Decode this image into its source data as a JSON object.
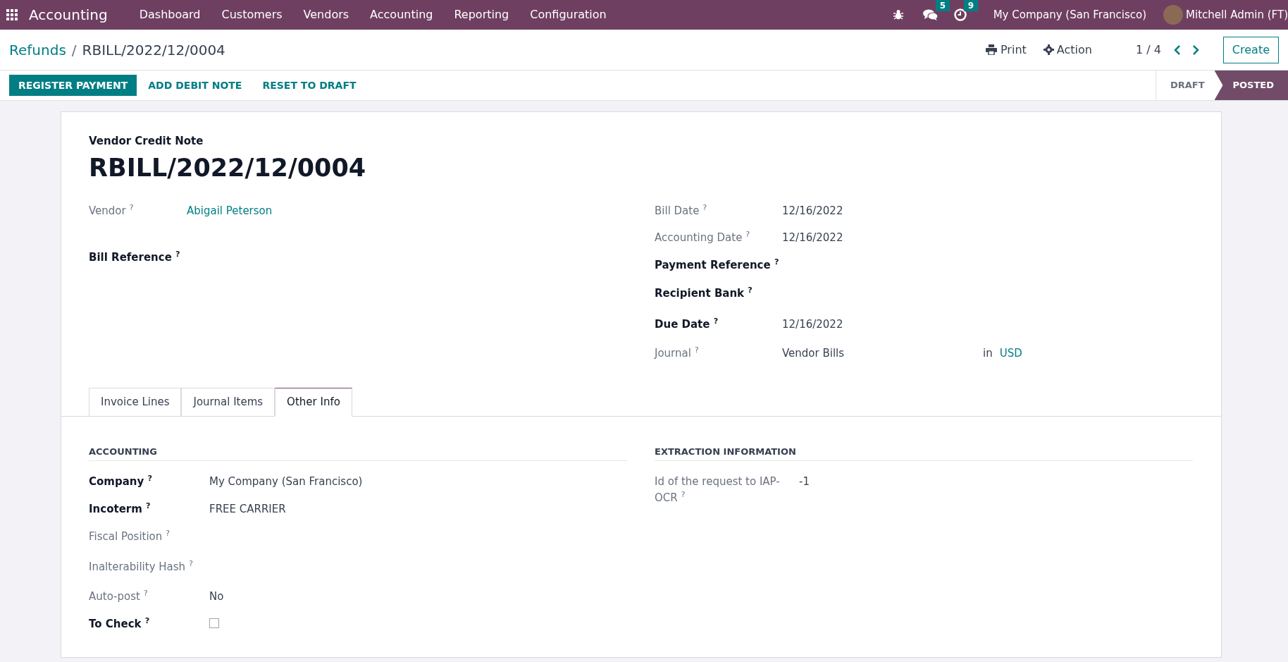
{
  "navbar": {
    "app_name": "Accounting",
    "menu": [
      "Dashboard",
      "Customers",
      "Vendors",
      "Accounting",
      "Reporting",
      "Configuration"
    ],
    "messages_count": "5",
    "activities_count": "9",
    "company": "My Company (San Francisco)",
    "user": "Mitchell Admin (FT)"
  },
  "control_panel": {
    "breadcrumb": [
      "Refunds",
      "RBILL/2022/12/0004"
    ],
    "breadcrumb_separator": "/",
    "print": "Print",
    "action": "Action",
    "pager": "1 / 4",
    "create": "Create"
  },
  "buttons": [
    {
      "label": "REGISTER PAYMENT",
      "primary": true
    },
    {
      "label": "ADD DEBIT NOTE",
      "primary": false
    },
    {
      "label": "RESET TO DRAFT",
      "primary": false
    }
  ],
  "status_steps": [
    {
      "label": "DRAFT",
      "selected": false
    },
    {
      "label": "POSTED",
      "selected": true
    }
  ],
  "form": {
    "type_label": "Vendor Credit Note",
    "name": "RBILL/2022/12/0004",
    "left_fields": [
      {
        "label": "Vendor $^{?}$",
        "required": false,
        "kind": "link",
        "value": "Abigail Peterson"
      },
      {
        "label": "Bill Reference $^{?}$",
        "required": true,
        "kind": "empty"
      }
    ],
    "right_fields": [
      {
        "label": "Bill Date $^{?}$",
        "required": false,
        "kind": "text",
        "value": "12/16/2022"
      },
      {
        "label": "Accounting Date $^{?}$",
        "required": false,
        "kind": "text",
        "value": "12/16/2022"
      },
      {
        "label": "Payment Reference $^{?}$",
        "required": true,
        "kind": "empty"
      },
      {
        "label": "Recipient Bank $^{?}$",
        "required": true,
        "kind": "empty"
      },
      {
        "label": "Due Date $^{?}$",
        "required": true,
        "kind": "text",
        "value": "12/16/2022"
      },
      {
        "label": "Journal $^{?}$",
        "required": false,
        "kind": "journal",
        "value": "Vendor Bills",
        "joiner": "in",
        "currency": "USD"
      }
    ],
    "tabs": [
      {
        "label": "Invoice Lines",
        "selected": false
      },
      {
        "label": "Journal Items",
        "selected": false
      },
      {
        "label": "Other Info",
        "selected": true
      }
    ],
    "sections": [
      {
        "title": "ACCOUNTING",
        "fields": [
          {
            "label": "Company $^{?}$",
            "required": true,
            "kind": "text",
            "value": "My Company (San Francisco)"
          },
          {
            "label": "Incoterm $^{?}$",
            "required": true,
            "kind": "text",
            "value": "FREE CARRIER"
          },
          {
            "label": "Fiscal Position $^{?}$",
            "required": false,
            "kind": "empty"
          },
          {
            "label": "Inalterability Hash $^{?}$",
            "required": false,
            "kind": "empty"
          },
          {
            "label": "Auto-post $^{?}$",
            "required": false,
            "kind": "text",
            "value": "No"
          },
          {
            "label": "To Check $^{?}$",
            "required": true,
            "kind": "checkbox",
            "checked": false
          }
        ]
      },
      {
        "title": "EXTRACTION INFORMATION",
        "fields": [
          {
            "label": "Id of the request to IAP-OCR $^{?}$",
            "required": false,
            "kind": "text",
            "value": "-1"
          }
        ]
      }
    ]
  }
}
